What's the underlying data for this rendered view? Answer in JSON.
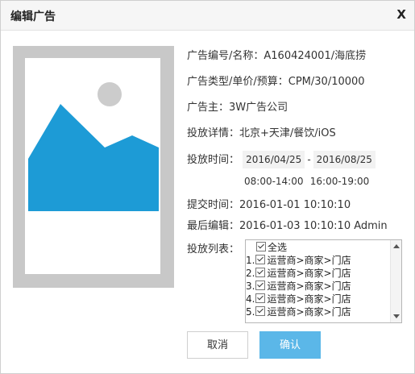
{
  "dialog": {
    "title": "编辑广告",
    "close_label": "X"
  },
  "info": {
    "id_label": "广告编号/名称：",
    "id_value": "A160424001/海底捞",
    "type_label": "广告类型/单价/预算：",
    "type_value": "CPM/30/10000",
    "owner_label": "广告主：",
    "owner_value": "3W广告公司",
    "detail_label": "投放详情：",
    "detail_value": "北京+天津/餐饮/iOS",
    "time_label": "投放时间：",
    "start_date": "2016/04/25",
    "date_separator": "-",
    "end_date": "2016/08/25",
    "slot1": "08:00-14:00",
    "slot2": "16:00-19:00",
    "submit_label": "提交时间：",
    "submit_value": "2016-01-01 10:10:10",
    "edit_label": "最后编辑：",
    "edit_value": "2016-01-03 10:10:10 Admin",
    "list_label": "投放列表："
  },
  "list": {
    "select_all": "全选",
    "items": [
      {
        "index": "1.",
        "label": "运营商>商家>门店",
        "checked": true
      },
      {
        "index": "2.",
        "label": "运营商>商家>门店",
        "checked": true
      },
      {
        "index": "3.",
        "label": "运营商>商家>门店",
        "checked": true
      },
      {
        "index": "4.",
        "label": "运营商>商家>门店",
        "checked": true
      },
      {
        "index": "5.",
        "label": "运营商>商家>门店",
        "checked": true
      }
    ]
  },
  "buttons": {
    "cancel": "取消",
    "confirm": "确认"
  },
  "colors": {
    "accent": "#5bb7e8",
    "image_mountain": "#1d9bd6",
    "image_sun": "#cccccc",
    "image_frame": "#c8c8c8"
  },
  "icons": {
    "preview": "image-placeholder-icon",
    "scroll_up": "arrow-up-icon",
    "scroll_down": "arrow-down-icon",
    "checkbox": "checkbox-checked-icon"
  }
}
